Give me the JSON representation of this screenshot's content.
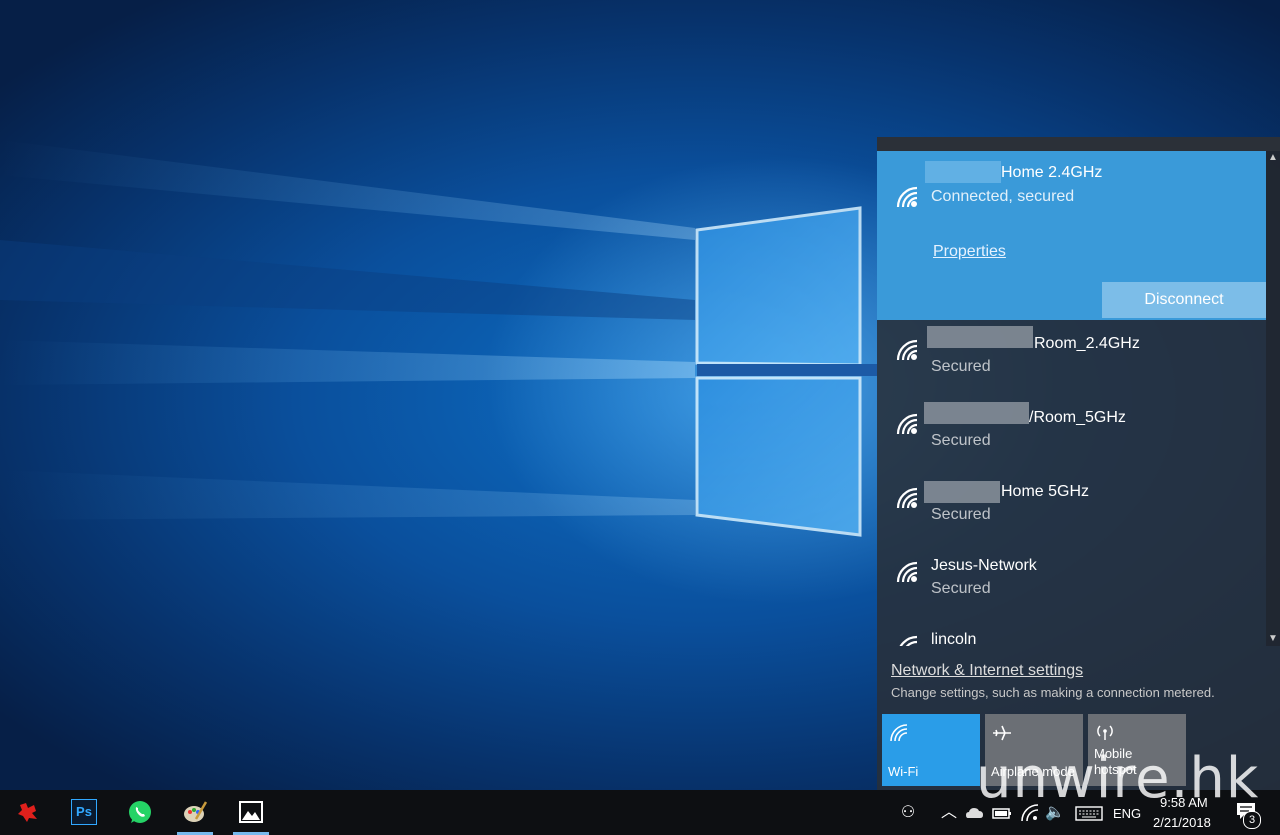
{
  "flyout": {
    "connected_network": {
      "name": "Home 2.4GHz",
      "status": "Connected, secured",
      "properties_label": "Properties",
      "disconnect_label": "Disconnect"
    },
    "networks": [
      {
        "name": "Room_2.4GHz",
        "status": "Secured"
      },
      {
        "name": "/Room_5GHz",
        "status": "Secured"
      },
      {
        "name": "Home 5GHz",
        "status": "Secured"
      },
      {
        "name": "Jesus-Network",
        "status": "Secured"
      },
      {
        "name": "lincoln",
        "status": ""
      }
    ],
    "settings_link": "Network & Internet settings",
    "settings_desc": "Change settings, such as making a connection metered.",
    "quick_actions": [
      {
        "label": "Wi-Fi",
        "state": "on",
        "icon": "wifi-icon"
      },
      {
        "label": "Airplane mode",
        "state": "off",
        "icon": "airplane-icon"
      },
      {
        "label": "Mobile hotspot",
        "state": "off",
        "icon": "hotspot-icon"
      }
    ]
  },
  "taskbar": {
    "apps": [
      {
        "name": "red-app",
        "icon": "red-app-icon"
      },
      {
        "name": "photoshop",
        "icon": "photoshop-icon",
        "text": "Ps"
      },
      {
        "name": "whatsapp",
        "icon": "whatsapp-icon"
      },
      {
        "name": "paint",
        "icon": "paint-icon"
      },
      {
        "name": "photos",
        "icon": "photos-icon"
      }
    ],
    "tray": {
      "language": "ENG",
      "time": "9:58 AM",
      "date": "2/21/2018",
      "notification_count": "3"
    }
  },
  "watermark": "unwire.hk",
  "colors": {
    "accent": "#3a9ad9",
    "wifi_tile": "#2a9de8",
    "taskbar": "#0d0f12"
  }
}
